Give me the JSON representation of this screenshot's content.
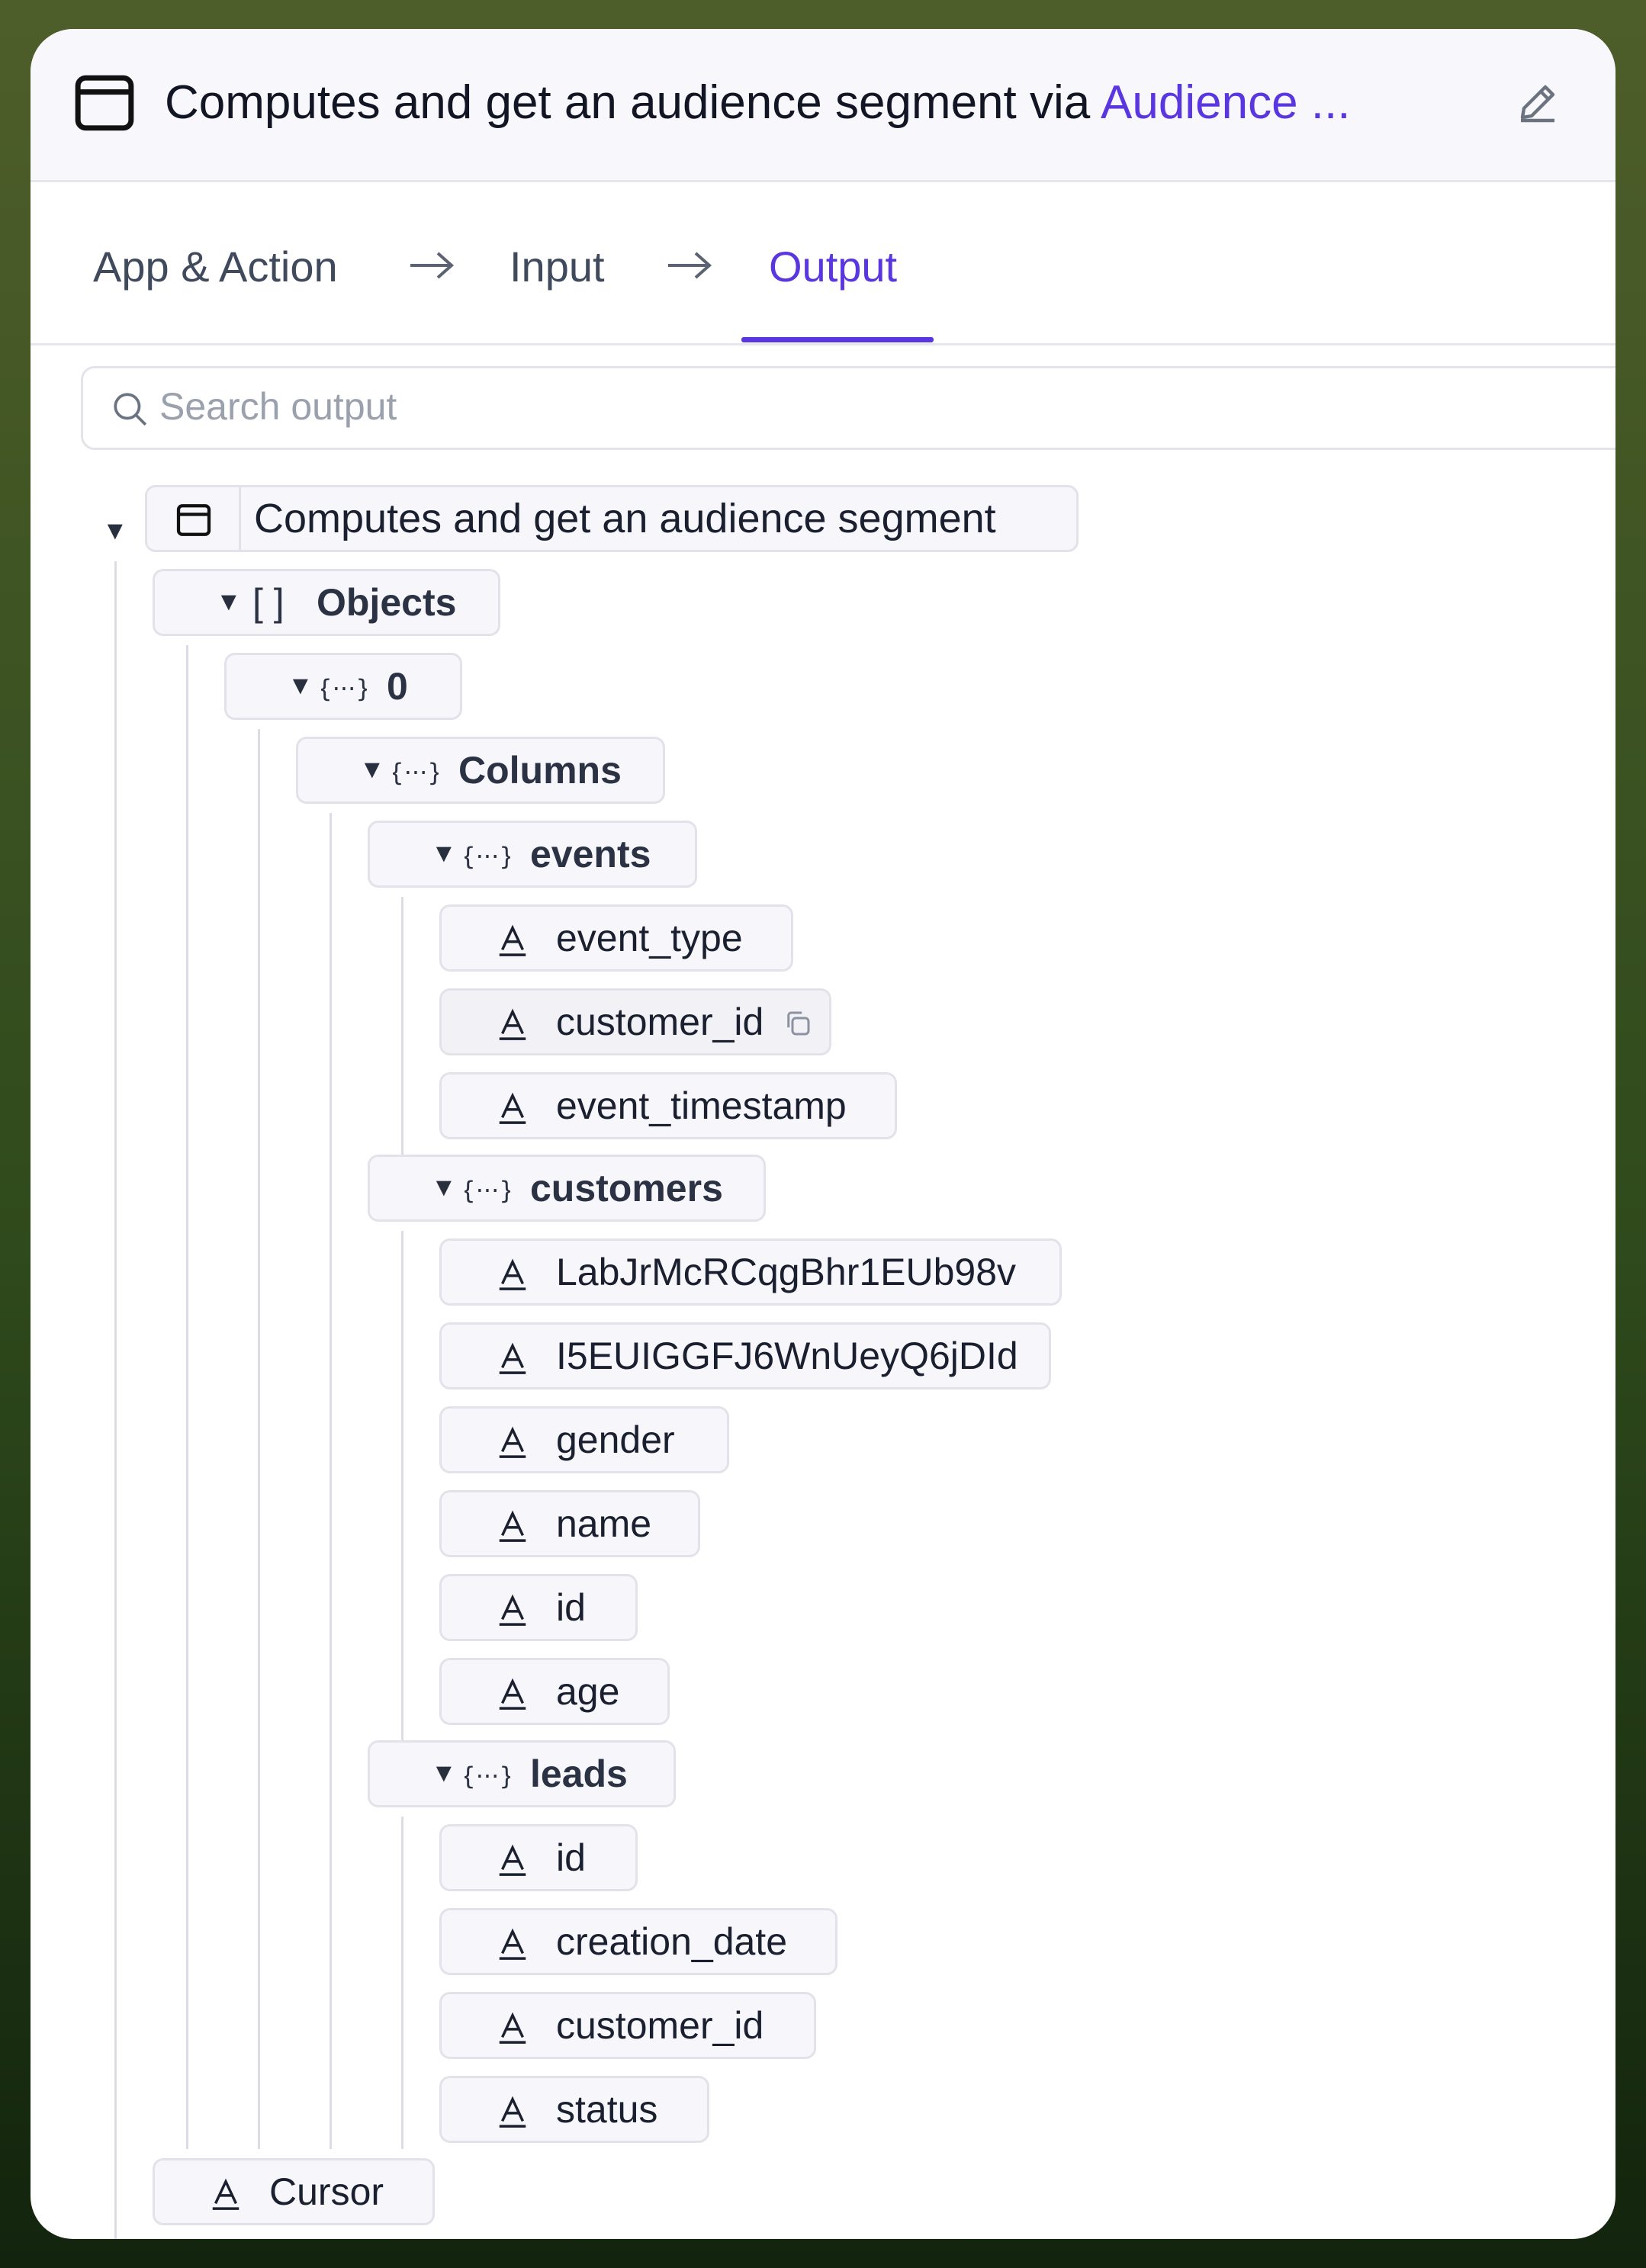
{
  "header": {
    "title_prefix": "Computes and get an audience segment via ",
    "title_app": "Audience ...",
    "icon": "window-icon",
    "edit_icon": "pencil-icon"
  },
  "tabs": [
    {
      "label": "App & Action"
    },
    {
      "label": "Input"
    },
    {
      "label": "Output",
      "active": true
    }
  ],
  "search": {
    "placeholder": "Search output",
    "value": ""
  },
  "tree": {
    "root": "Computes and get an audience segment",
    "objects": "Objects",
    "objects_bracket": "[ ]",
    "item0": "0",
    "columns": "Columns",
    "events": {
      "label": "events",
      "fields": [
        "event_type",
        "customer_id",
        "event_timestamp"
      ]
    },
    "customers": {
      "label": "customers",
      "fields": [
        "LabJrMcRCqgBhr1EUb98v",
        "I5EUIGGFJ6WnUeyQ6jDId",
        "gender",
        "name",
        "id",
        "age"
      ]
    },
    "leads": {
      "label": "leads",
      "fields": [
        "id",
        "creation_date",
        "customer_id",
        "status"
      ]
    },
    "cursor": "Cursor"
  },
  "colors": {
    "accent": "#5a36e0",
    "text": "#1a2030",
    "border": "#e2e2ea"
  }
}
